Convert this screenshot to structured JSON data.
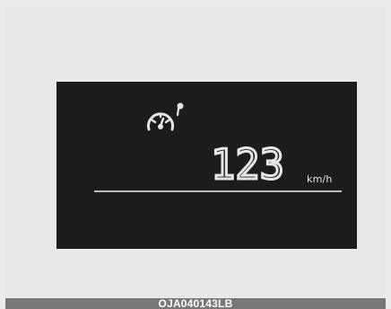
{
  "cluster": {
    "icon": "speedometer-icon",
    "speed": "123",
    "unit": "km/h"
  },
  "caption": {
    "code": "OJA040143LB"
  },
  "colors": {
    "background": "#ececec",
    "display": "#1c1c1c",
    "foreground": "#e6e6e6",
    "divider": "#bdbdbd",
    "caption_bar": "#777777"
  }
}
